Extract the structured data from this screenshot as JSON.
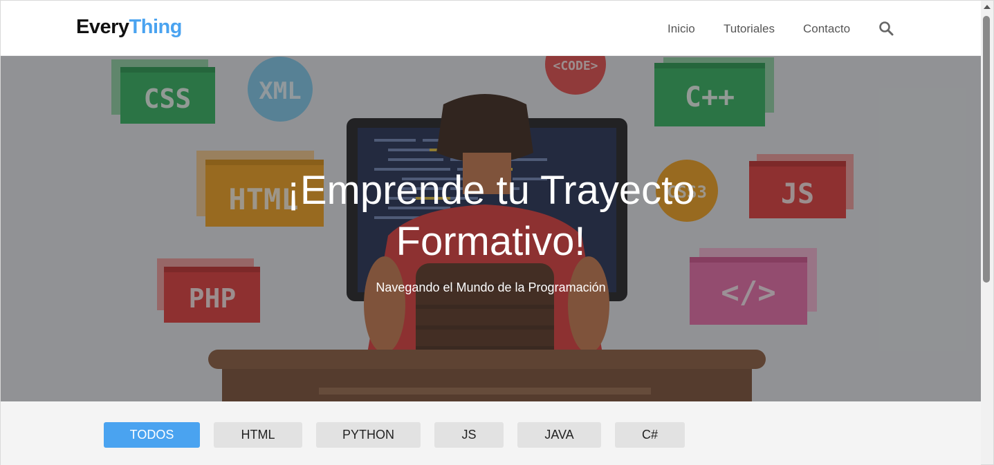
{
  "header": {
    "logo_part1": "Every",
    "logo_part2": "Thing",
    "nav": [
      "Inicio",
      "Tutoriales",
      "Contacto"
    ],
    "search_icon": "search-icon"
  },
  "hero": {
    "title_line1": "¡Emprende tu Trayecto",
    "title_line2": "Formativo!",
    "subtitle": "Navegando el Mundo de la Programación",
    "image_labels": [
      "CSS",
      "XML",
      "<CODE>",
      "C++",
      "HTML",
      "CSS3",
      "JS",
      "PHP",
      "</>"
    ]
  },
  "filters": {
    "buttons": [
      "TODOS",
      "HTML",
      "PYTHON",
      "JS",
      "JAVA",
      "C#"
    ],
    "active": "TODOS"
  },
  "colors": {
    "accent": "#4aa3f0",
    "filter_bg": "#e2e2e2",
    "section_bg": "#f4f4f4"
  }
}
